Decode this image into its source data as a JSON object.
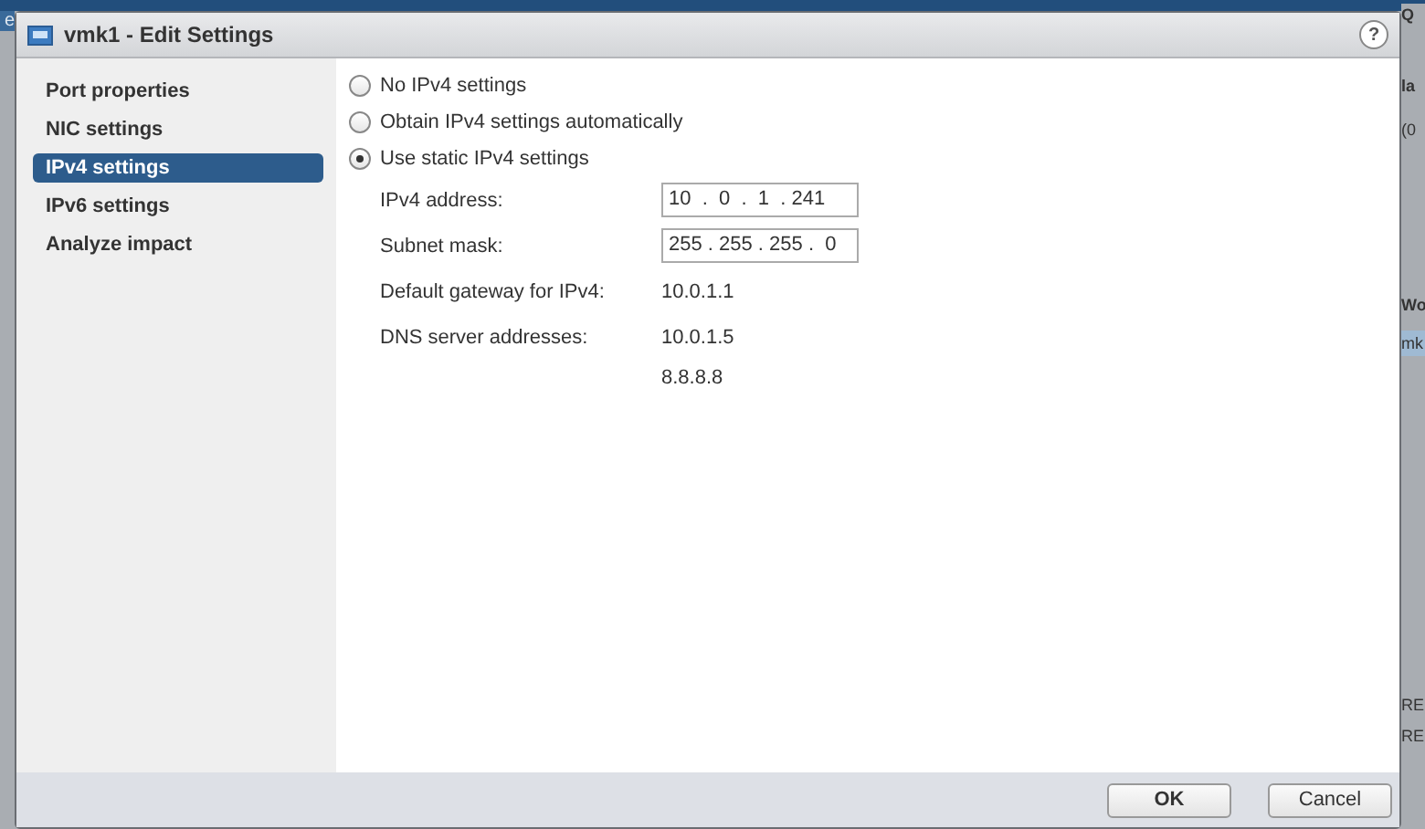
{
  "background": {
    "left_fragments": [
      "e"
    ],
    "right_fragments": [
      {
        "text": "Q",
        "kind": "header"
      },
      {
        "text": "la",
        "kind": "header"
      },
      {
        "text": "(0",
        "kind": "plain"
      },
      {
        "text": "Wo",
        "kind": "header"
      },
      {
        "text": "mk",
        "kind": "selected"
      },
      {
        "text": "RE",
        "kind": "plain"
      },
      {
        "text": "RE",
        "kind": "plain"
      }
    ]
  },
  "window": {
    "title": "vmk1 - Edit Settings",
    "help": "?"
  },
  "sidebar": {
    "items": [
      {
        "label": "Port properties",
        "selected": false
      },
      {
        "label": "NIC settings",
        "selected": false
      },
      {
        "label": "IPv4 settings",
        "selected": true
      },
      {
        "label": "IPv6 settings",
        "selected": false
      },
      {
        "label": "Analyze impact",
        "selected": false
      }
    ]
  },
  "options": [
    {
      "label": "No IPv4 settings",
      "selected": false
    },
    {
      "label": "Obtain IPv4 settings automatically",
      "selected": false
    },
    {
      "label": "Use static IPv4 settings",
      "selected": true
    }
  ],
  "fields": [
    {
      "label": "IPv4 address:",
      "kind": "ip",
      "value": "10  .  0  .  1  . 241"
    },
    {
      "label": "Subnet mask:",
      "kind": "ip",
      "value": "255 . 255 . 255 .  0"
    },
    {
      "label": "Default gateway for IPv4:",
      "kind": "text",
      "values": [
        "10.0.1.1"
      ]
    },
    {
      "label": "DNS server addresses:",
      "kind": "text",
      "values": [
        "10.0.1.5",
        "8.8.8.8"
      ]
    }
  ],
  "buttons": [
    "OK",
    "Cancel"
  ]
}
